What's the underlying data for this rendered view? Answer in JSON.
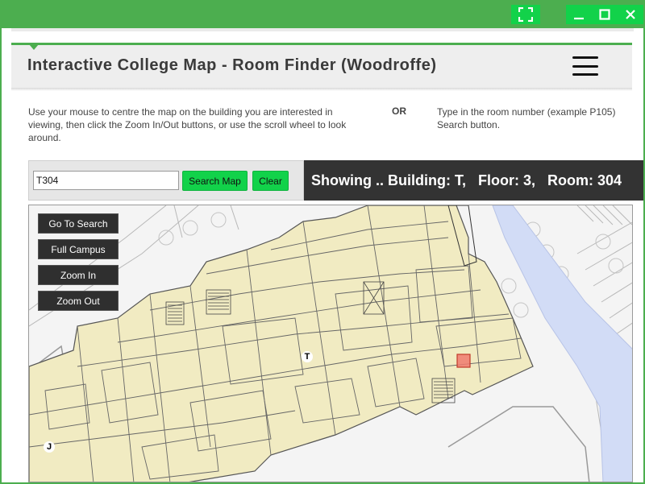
{
  "window": {
    "fullscreen_icon": "fullscreen-icon",
    "minimize_icon": "minimize-icon",
    "maximize_icon": "maximize-icon",
    "close_icon": "close-icon"
  },
  "header": {
    "title": "Interactive College Map - Room Finder (Woodroffe)",
    "menu_icon": "hamburger-menu-icon"
  },
  "instructions": {
    "left": "Use your mouse to centre the map on the building you are interested in viewing, then click the Zoom In/Out buttons, or use the scroll wheel to look around.",
    "or": "OR",
    "right_line1": "Type in the room number (example P105)",
    "right_line2": "Search button."
  },
  "search": {
    "value": "T304",
    "search_button": "Search Map",
    "clear_button": "Clear"
  },
  "status": {
    "text": "Showing .. Building: T,   Floor: 3,   Room: 304"
  },
  "map": {
    "buttons": {
      "go_to_search": "Go To Search",
      "full_campus": "Full Campus",
      "zoom_in": "Zoom In",
      "zoom_out": "Zoom Out"
    },
    "building_labels": {
      "t": "T",
      "j": "J"
    },
    "colors": {
      "building": "#f1ebc2",
      "water": "#d2dcf6",
      "highlight": "#f07a6e",
      "accent": "#12d24a",
      "chrome": "#4cae4f"
    }
  }
}
